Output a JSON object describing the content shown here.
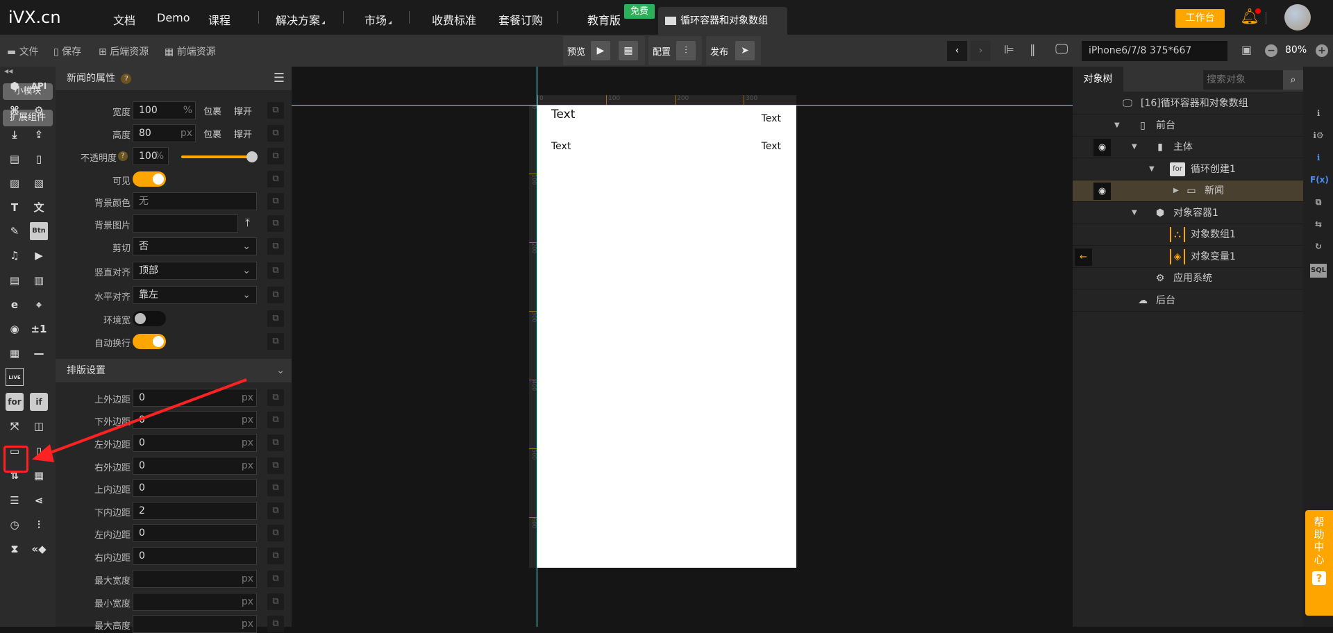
{
  "topnav": {
    "logo": "iVX.cn",
    "items": [
      "文档",
      "Demo",
      "课程",
      "解决方案",
      "市场",
      "收费标准",
      "套餐订购",
      "教育版"
    ],
    "free_badge": "免费",
    "active_tab": "循环容器和对象数组",
    "workbench": "工作台"
  },
  "toolbar": {
    "file": "文件",
    "save": "保存",
    "backend": "后端资源",
    "frontend": "前端资源",
    "preview": "预览",
    "config": "配置",
    "publish": "发布",
    "device": "iPhone6/7/8 375*667",
    "zoom": "80%"
  },
  "leftbar": {
    "small_module": "小模块",
    "extensions": "扩展组件",
    "api": "API",
    "btn": "Btn",
    "icon": "Icon",
    "plus1": "±1",
    "live": "LIVE",
    "for": "for",
    "if": "if"
  },
  "props": {
    "title": "新闻的属性",
    "rows": [
      {
        "label": "宽度",
        "value": "100",
        "unit": "%",
        "wrap": "包裹",
        "expand": "撑开"
      },
      {
        "label": "高度",
        "value": "80",
        "unit": "px",
        "wrap": "包裹",
        "expand": "撑开"
      },
      {
        "label": "不透明度",
        "value": "100",
        "unit": "%",
        "slider": 1.0
      },
      {
        "label": "可见",
        "toggle": true
      },
      {
        "label": "背景颜色",
        "value": "无"
      },
      {
        "label": "背景图片",
        "value": ""
      },
      {
        "label": "剪切",
        "value": "否"
      },
      {
        "label": "竖直对齐",
        "value": "顶部"
      },
      {
        "label": "水平对齐",
        "value": "靠左"
      },
      {
        "label": "环境宽",
        "toggle": false
      },
      {
        "label": "自动换行",
        "toggle": true
      }
    ],
    "layout_title": "排版设置",
    "layout_rows": [
      {
        "label": "上外边距",
        "value": "0",
        "unit": "px"
      },
      {
        "label": "下外边距",
        "value": "0",
        "unit": "px"
      },
      {
        "label": "左外边距",
        "value": "0",
        "unit": "px"
      },
      {
        "label": "右外边距",
        "value": "0",
        "unit": "px"
      },
      {
        "label": "上内边距",
        "value": "0",
        "unit": ""
      },
      {
        "label": "下内边距",
        "value": "2",
        "unit": ""
      },
      {
        "label": "左内边距",
        "value": "0",
        "unit": ""
      },
      {
        "label": "右内边距",
        "value": "0",
        "unit": ""
      },
      {
        "label": "最大宽度",
        "value": "",
        "unit": "px"
      },
      {
        "label": "最小宽度",
        "value": "",
        "unit": "px"
      },
      {
        "label": "最大高度",
        "value": "",
        "unit": "px"
      }
    ]
  },
  "canvas": {
    "ruler_x": [
      "0",
      "100",
      "200",
      "300"
    ],
    "ruler_y": [
      "0",
      "100",
      "200",
      "300",
      "400",
      "500",
      "600"
    ],
    "texts": [
      "Text",
      "Text",
      "Text",
      "Text"
    ]
  },
  "tree": {
    "tab": "对象树",
    "search_placeholder": "搜索对象",
    "nodes": [
      {
        "label": "[16]循环容器和对象数组",
        "icon": "app-icon"
      },
      {
        "label": "前台",
        "icon": "phone-icon"
      },
      {
        "label": "主体",
        "icon": "body-icon"
      },
      {
        "label": "循环创建1",
        "icon": "for-icon"
      },
      {
        "label": "新闻",
        "icon": "row-icon"
      },
      {
        "label": "对象容器1",
        "icon": "box-icon"
      },
      {
        "label": "对象数组1",
        "icon": "object-array-icon"
      },
      {
        "label": "对象变量1",
        "icon": "object-variable-icon"
      },
      {
        "label": "应用系统",
        "icon": "gear-icon"
      },
      {
        "label": "后台",
        "icon": "server-icon"
      }
    ]
  },
  "rstrip": {
    "fx": "F(x)",
    "sql": "SQL"
  },
  "help": "帮助中心",
  "colors": {
    "accent": "#ffa500",
    "selected_row": "#4a4030",
    "guide": "#5ff"
  }
}
